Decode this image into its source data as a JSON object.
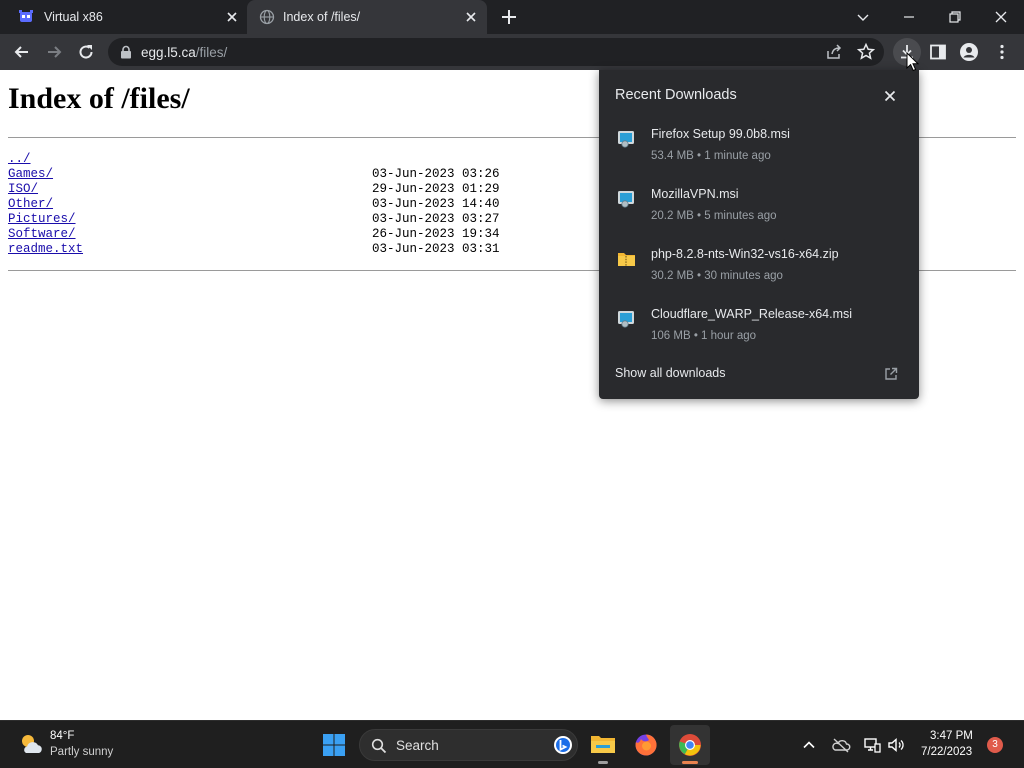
{
  "browser": {
    "tabs": [
      {
        "title": "Virtual x86",
        "icon": "virtual-x86-favicon",
        "active": false
      },
      {
        "title": "Index of /files/",
        "icon": "globe-icon",
        "active": true
      }
    ],
    "address": {
      "host": "egg.l5.ca",
      "path": "/files/"
    }
  },
  "page": {
    "heading": "Index of /files/",
    "entries": [
      {
        "name": "../",
        "date": ""
      },
      {
        "name": "Games/",
        "date": "03-Jun-2023 03:26"
      },
      {
        "name": "ISO/",
        "date": "29-Jun-2023 01:29"
      },
      {
        "name": "Other/",
        "date": "03-Jun-2023 14:40"
      },
      {
        "name": "Pictures/",
        "date": "03-Jun-2023 03:27"
      },
      {
        "name": "Software/",
        "date": "26-Jun-2023 19:34"
      },
      {
        "name": "readme.txt",
        "date": "03-Jun-2023 03:31"
      }
    ]
  },
  "downloads_panel": {
    "title": "Recent Downloads",
    "items": [
      {
        "name": "Firefox Setup 99.0b8.msi",
        "meta": "53.4 MB • 1 minute ago",
        "icon": "msi-installer-icon"
      },
      {
        "name": "MozillaVPN.msi",
        "meta": "20.2 MB • 5 minutes ago",
        "icon": "msi-installer-icon"
      },
      {
        "name": "php-8.2.8-nts-Win32-vs16-x64.zip",
        "meta": "30.2 MB • 30 minutes ago",
        "icon": "zip-folder-icon"
      },
      {
        "name": "Cloudflare_WARP_Release-x64.msi",
        "meta": "106 MB • 1 hour ago",
        "icon": "msi-installer-icon"
      }
    ],
    "show_all": "Show all downloads"
  },
  "taskbar": {
    "weather": {
      "temp": "84°F",
      "desc": "Partly sunny"
    },
    "search_placeholder": "Search",
    "clock": {
      "time": "3:47 PM",
      "date": "7/22/2023"
    },
    "notification_count": "3"
  },
  "colors": {
    "tabstrip": "#202124",
    "toolbar": "#35363a",
    "panel": "#292a2d",
    "link": "#1a0dab",
    "accent_chrome_indicator": "#e8834f"
  }
}
